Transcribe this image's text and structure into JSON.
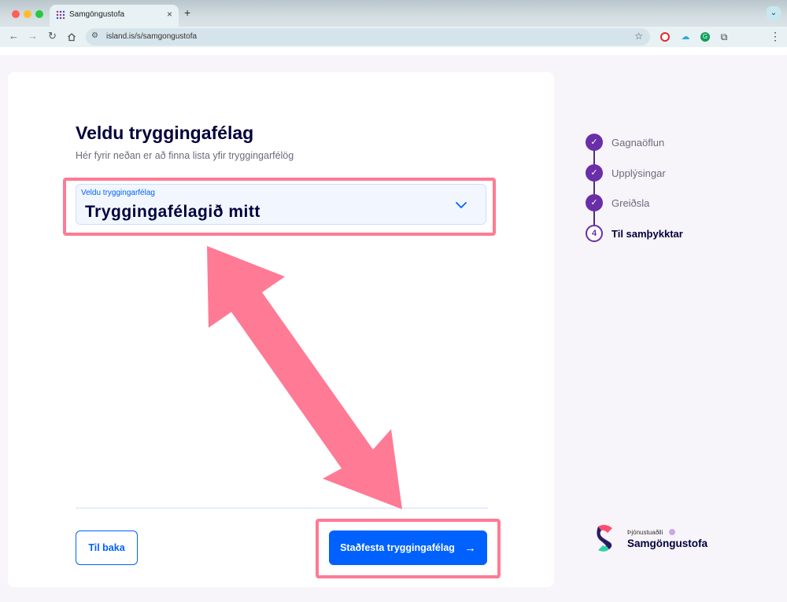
{
  "browser": {
    "tab_title": "Samgöngustofa",
    "tab_close": "×",
    "new_tab": "+",
    "url": "island.is/s/samgongustofa"
  },
  "page": {
    "title": "Veldu tryggingafélag",
    "subtitle": "Hér fyrir neðan er að finna lista yfir tryggingarfélög",
    "select": {
      "label": "Veldu tryggingarfélag",
      "value": "Tryggingafélagið mitt"
    },
    "back_button": "Til baka",
    "confirm_button": "Staðfesta tryggingafélag",
    "confirm_arrow": "→"
  },
  "stepper": {
    "steps": [
      {
        "label": "Gagnaöflun",
        "status": "done",
        "marker": "✓"
      },
      {
        "label": "Upplýsingar",
        "status": "done",
        "marker": "✓"
      },
      {
        "label": "Greiðsla",
        "status": "done",
        "marker": "✓"
      },
      {
        "label": "Til samþykktar",
        "status": "current",
        "marker": "4"
      }
    ]
  },
  "provider": {
    "caption": "Þjónustuaðili",
    "name": "Samgöngustofa"
  },
  "colors": {
    "primary_blue": "#0061ff",
    "step_purple": "#6a2ea8",
    "annotation_pink": "#ff7a94"
  }
}
